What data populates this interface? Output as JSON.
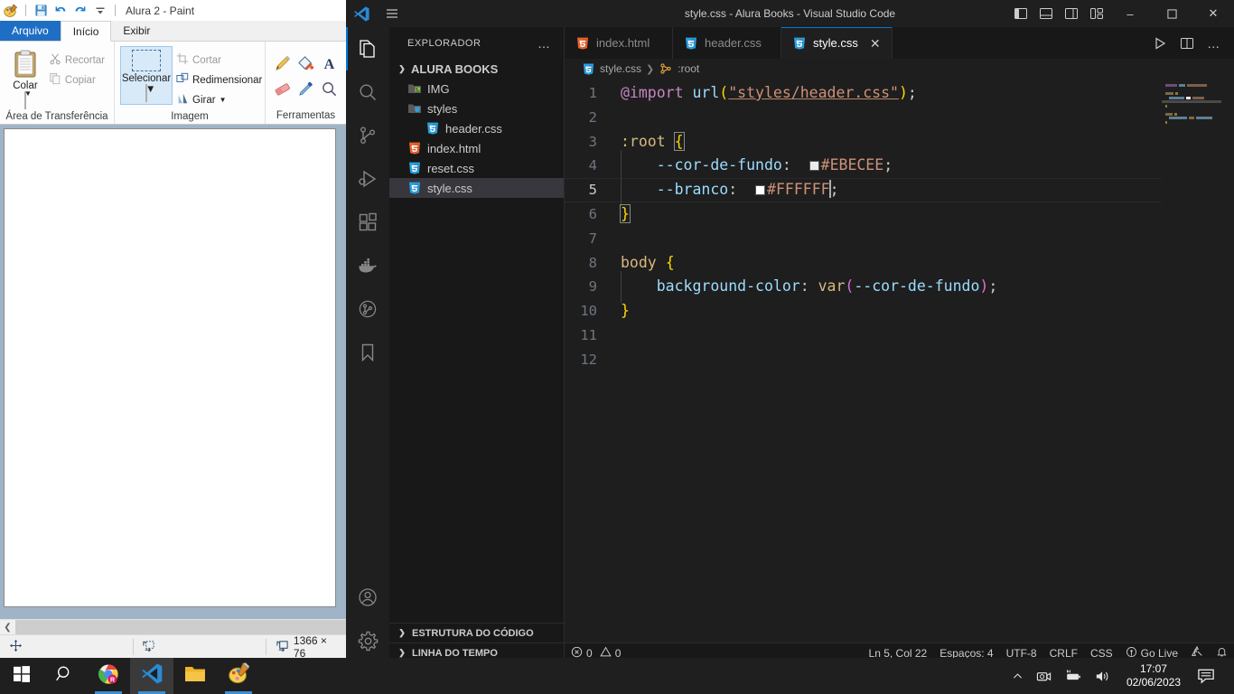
{
  "paint": {
    "title": "Alura 2 - Paint",
    "quick_access": [
      "paint-app-icon",
      "save-icon",
      "undo-icon",
      "redo-icon",
      "customize-caret-icon"
    ],
    "tabs": [
      {
        "label": "Arquivo",
        "type": "file"
      },
      {
        "label": "Início",
        "type": "active"
      },
      {
        "label": "Exibir",
        "type": "normal"
      }
    ],
    "groups": [
      {
        "label": "Área de Transferência",
        "big_button": "Colar",
        "items": [
          {
            "label": "Recortar",
            "icon": "scissors-icon",
            "enabled": false
          },
          {
            "label": "Copiar",
            "icon": "copy-icon",
            "enabled": false
          }
        ]
      },
      {
        "label": "Imagem",
        "big_button": "Selecionar",
        "items": [
          {
            "label": "Cortar",
            "icon": "crop-icon",
            "enabled": false
          },
          {
            "label": "Redimensionar",
            "icon": "resize-icon",
            "enabled": true
          },
          {
            "label": "Girar",
            "icon": "rotate-icon",
            "enabled": true
          }
        ]
      },
      {
        "label": "Ferramentas",
        "tools": [
          "pencil-icon",
          "fill-icon",
          "text-icon",
          "eraser-icon",
          "color-picker-icon",
          "magnifier-icon"
        ]
      }
    ],
    "statusbar": {
      "position_icon": "cursor-position-icon",
      "selection_icon": "selection-size-icon",
      "canvas_icon": "canvas-size-icon",
      "canvas_size": "1366 × 76"
    }
  },
  "vscode": {
    "window_title": "style.css - Alura Books - Visual Studio Code",
    "titlebar_buttons": [
      "toggle-primary-sidebar",
      "toggle-panel",
      "toggle-secondary-sidebar",
      "customize-layout"
    ],
    "window_controls": {
      "minimize": "–",
      "maximize": "❐",
      "close": "✕"
    },
    "activitybar": [
      {
        "name": "explorer",
        "icon": "files-icon",
        "active": true
      },
      {
        "name": "search",
        "icon": "search-icon",
        "active": false
      },
      {
        "name": "source-control",
        "icon": "source-control-icon",
        "active": false
      },
      {
        "name": "run-and-debug",
        "icon": "run-debug-icon",
        "active": false
      },
      {
        "name": "extensions",
        "icon": "extensions-icon",
        "active": false
      },
      {
        "name": "docker",
        "icon": "docker-icon",
        "active": false
      },
      {
        "name": "git-graph",
        "icon": "git-graph-icon",
        "active": false
      },
      {
        "name": "bookmarks",
        "icon": "bookmark-icon",
        "active": false
      }
    ],
    "activitybar_bottom": [
      {
        "name": "accounts",
        "icon": "account-icon"
      },
      {
        "name": "settings",
        "icon": "gear-icon"
      }
    ],
    "sidebar": {
      "title": "EXPLORADOR",
      "more_actions": "…",
      "root_folder": "ALURA BOOKS",
      "tree": [
        {
          "label": "IMG",
          "icon": "folder-img-icon",
          "depth": 1,
          "selected": false
        },
        {
          "label": "styles",
          "icon": "folder-styles-icon",
          "depth": 1,
          "selected": false
        },
        {
          "label": "header.css",
          "icon": "css-file-icon",
          "depth": 2,
          "selected": false
        },
        {
          "label": "index.html",
          "icon": "html-file-icon",
          "depth": 1,
          "selected": false
        },
        {
          "label": "reset.css",
          "icon": "css-file-icon",
          "depth": 1,
          "selected": false
        },
        {
          "label": "style.css",
          "icon": "css-file-icon",
          "depth": 1,
          "selected": true
        }
      ],
      "panels": [
        {
          "label": "ESTRUTURA DO CÓDIGO"
        },
        {
          "label": "LINHA DO TEMPO"
        }
      ]
    },
    "tabs": [
      {
        "label": "index.html",
        "icon": "html-file-icon",
        "active": false
      },
      {
        "label": "header.css",
        "icon": "css-file-icon",
        "active": false
      },
      {
        "label": "style.css",
        "icon": "css-file-icon",
        "active": true,
        "close": "✕"
      }
    ],
    "tabbar_actions": [
      "run-icon",
      "split-editor-icon",
      "more-actions-icon"
    ],
    "breadcrumbs": [
      {
        "label": "style.css",
        "icon": "css-file-icon"
      },
      {
        "label": ":root",
        "icon": "css-selector-icon"
      }
    ],
    "code_lines": [
      {
        "n": "1"
      },
      {
        "n": "2"
      },
      {
        "n": "3"
      },
      {
        "n": "4"
      },
      {
        "n": "5"
      },
      {
        "n": "6"
      },
      {
        "n": "7"
      },
      {
        "n": "8"
      },
      {
        "n": "9"
      },
      {
        "n": "10"
      },
      {
        "n": "11"
      },
      {
        "n": "12"
      }
    ],
    "code_text": {
      "l1_at": "@import",
      "l1_fn": "url",
      "l1_open": "(",
      "l1_str": "\"styles/header.css\"",
      "l1_close": ")",
      "l1_semi": ";",
      "l3_sel": ":root",
      "l3_brace": "{",
      "l4_prop": "--cor-de-fundo",
      "l4_colon": ":",
      "l4_val": "#EBECEE",
      "l4_semi": ";",
      "l5_prop": "--branco",
      "l5_colon": ":",
      "l5_val": "#FFFFFF",
      "l5_semi": ";",
      "l6_brace": "}",
      "l8_sel": "body",
      "l8_brace": "{",
      "l9_prop": "background-color",
      "l9_colon": ":",
      "l9_fn": "var",
      "l9_open": "(",
      "l9_arg": "--cor-de-fundo",
      "l9_close": ")",
      "l9_semi": ";",
      "l10_brace": "}"
    },
    "swatches": {
      "cor_de_fundo": "#EBECEE",
      "branco": "#FFFFFF"
    },
    "statusbar": {
      "errors": "0",
      "warnings": "0",
      "cursor": "Ln 5, Col 22",
      "indentation": "Espaços: 4",
      "encoding": "UTF-8",
      "eol": "CRLF",
      "language": "CSS",
      "go_live": "Go Live",
      "remote_icon": "remote-window-icon",
      "bell_icon": "bell-icon"
    },
    "accent": "#0078d4"
  },
  "taskbar": {
    "items": [
      {
        "name": "start",
        "icon": "windows-start-icon",
        "running": false,
        "active": false
      },
      {
        "name": "search",
        "icon": "search-icon",
        "running": false,
        "active": false
      },
      {
        "name": "chrome",
        "icon": "chrome-icon",
        "running": true,
        "active": false
      },
      {
        "name": "vscode",
        "icon": "vscode-icon",
        "running": true,
        "active": true
      },
      {
        "name": "file-explorer",
        "icon": "folder-icon",
        "running": false,
        "active": false
      },
      {
        "name": "paint",
        "icon": "paint-icon",
        "running": true,
        "active": false
      }
    ],
    "tray": {
      "show_hidden": "show-hidden-icons-chevron",
      "icons": [
        "camera-icon",
        "battery-icon",
        "volume-icon"
      ],
      "time": "17:07",
      "date": "02/06/2023",
      "notifications_icon": "action-center-icon"
    }
  }
}
